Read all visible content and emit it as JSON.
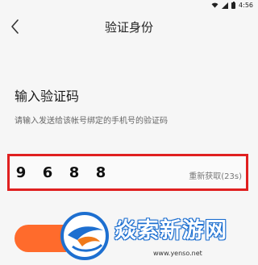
{
  "status_bar": {
    "time": "4:56"
  },
  "app_bar": {
    "title": "验证身份",
    "back_icon": "chevron-left-icon"
  },
  "main": {
    "heading": "输入验证码",
    "subtext": "请输入发送给该帐号绑定的手机号的验证码",
    "code_digits": [
      "9",
      "6",
      "8",
      "8"
    ],
    "resend_label": "重新获取(23s)"
  },
  "watermark": {
    "text": "焱索新游网",
    "url": "www.yenso.net"
  },
  "colors": {
    "highlight_border": "#e02020",
    "accent": "#ff6b2c"
  }
}
